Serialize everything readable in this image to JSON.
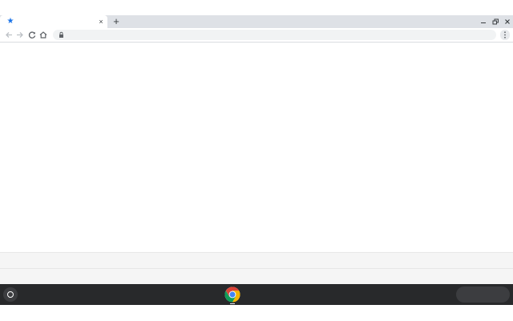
{
  "tab": {
    "title": "",
    "favicon": "bookmark-star-icon",
    "close_label": "×"
  },
  "tabstrip": {
    "new_tab_label": "+"
  },
  "window_controls": {
    "minimize": "–",
    "restore": "⧉",
    "close": "×"
  },
  "toolbar": {
    "back": "←",
    "forward": "→",
    "reload": "↻",
    "home": "⌂"
  },
  "omnibox": {
    "value": "",
    "placeholder": "",
    "security": "lock-icon"
  },
  "shelf": {
    "pinned_apps": [
      "chrome-icon"
    ]
  },
  "colors": {
    "tabstrip_bg": "#dee1e6",
    "shelf_bg": "#28292b",
    "accent": "#1a73e8"
  }
}
